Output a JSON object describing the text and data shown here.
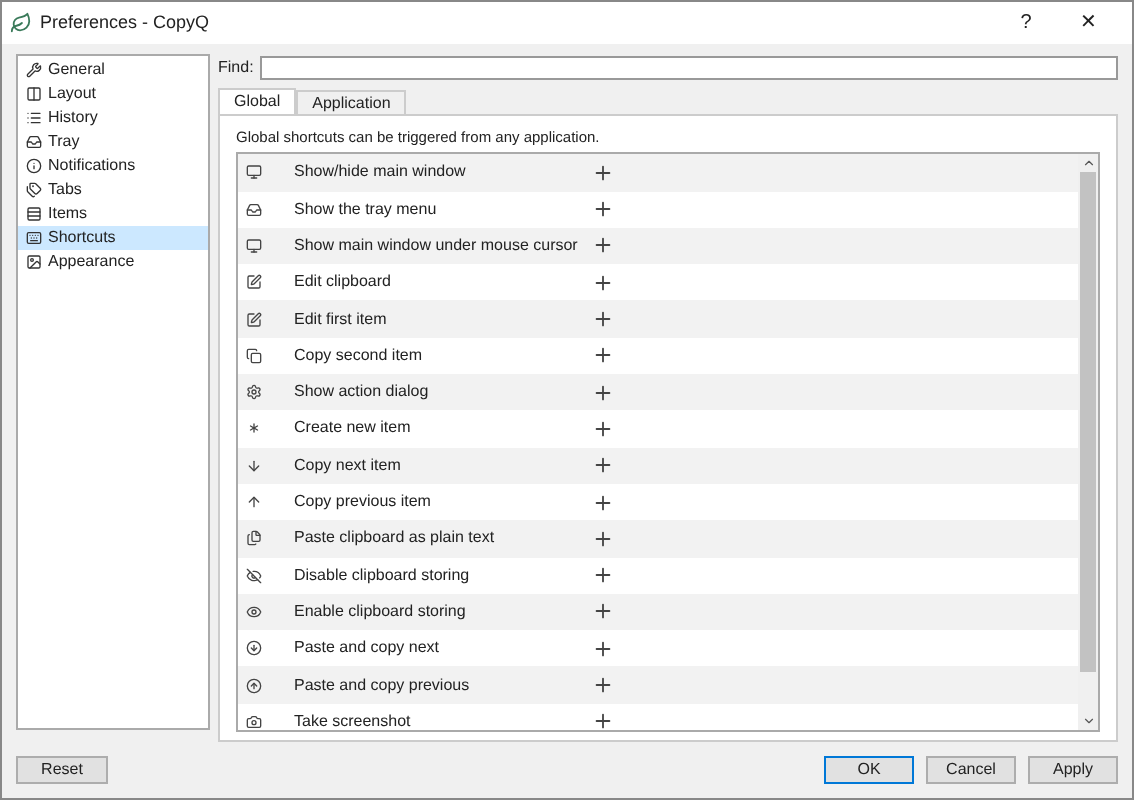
{
  "window": {
    "title": "Preferences - CopyQ",
    "help": "?",
    "close": "✕"
  },
  "sidebar": {
    "items": [
      {
        "label": "General",
        "selected": false
      },
      {
        "label": "Layout",
        "selected": false
      },
      {
        "label": "History",
        "selected": false
      },
      {
        "label": "Tray",
        "selected": false
      },
      {
        "label": "Notifications",
        "selected": false
      },
      {
        "label": "Tabs",
        "selected": false
      },
      {
        "label": "Items",
        "selected": false
      },
      {
        "label": "Shortcuts",
        "selected": true
      },
      {
        "label": "Appearance",
        "selected": false
      }
    ]
  },
  "find": {
    "label": "Find:"
  },
  "tabs": [
    {
      "label": "Global",
      "selected": true
    },
    {
      "label": "Application",
      "selected": false
    }
  ],
  "description": "Global shortcuts can be triggered from any application.",
  "shortcuts": [
    {
      "label": "Show/hide main window"
    },
    {
      "label": "Show the tray menu"
    },
    {
      "label": "Show main window under mouse cursor"
    },
    {
      "label": "Edit clipboard"
    },
    {
      "label": "Edit first item"
    },
    {
      "label": "Copy second item"
    },
    {
      "label": "Show action dialog"
    },
    {
      "label": "Create new item"
    },
    {
      "label": "Copy next item"
    },
    {
      "label": "Copy previous item"
    },
    {
      "label": "Paste clipboard as plain text"
    },
    {
      "label": "Disable clipboard storing"
    },
    {
      "label": "Enable clipboard storing"
    },
    {
      "label": "Paste and copy next"
    },
    {
      "label": "Paste and copy previous"
    },
    {
      "label": "Take screenshot"
    }
  ],
  "buttons": {
    "reset": "Reset",
    "ok": "OK",
    "cancel": "Cancel",
    "apply": "Apply"
  }
}
